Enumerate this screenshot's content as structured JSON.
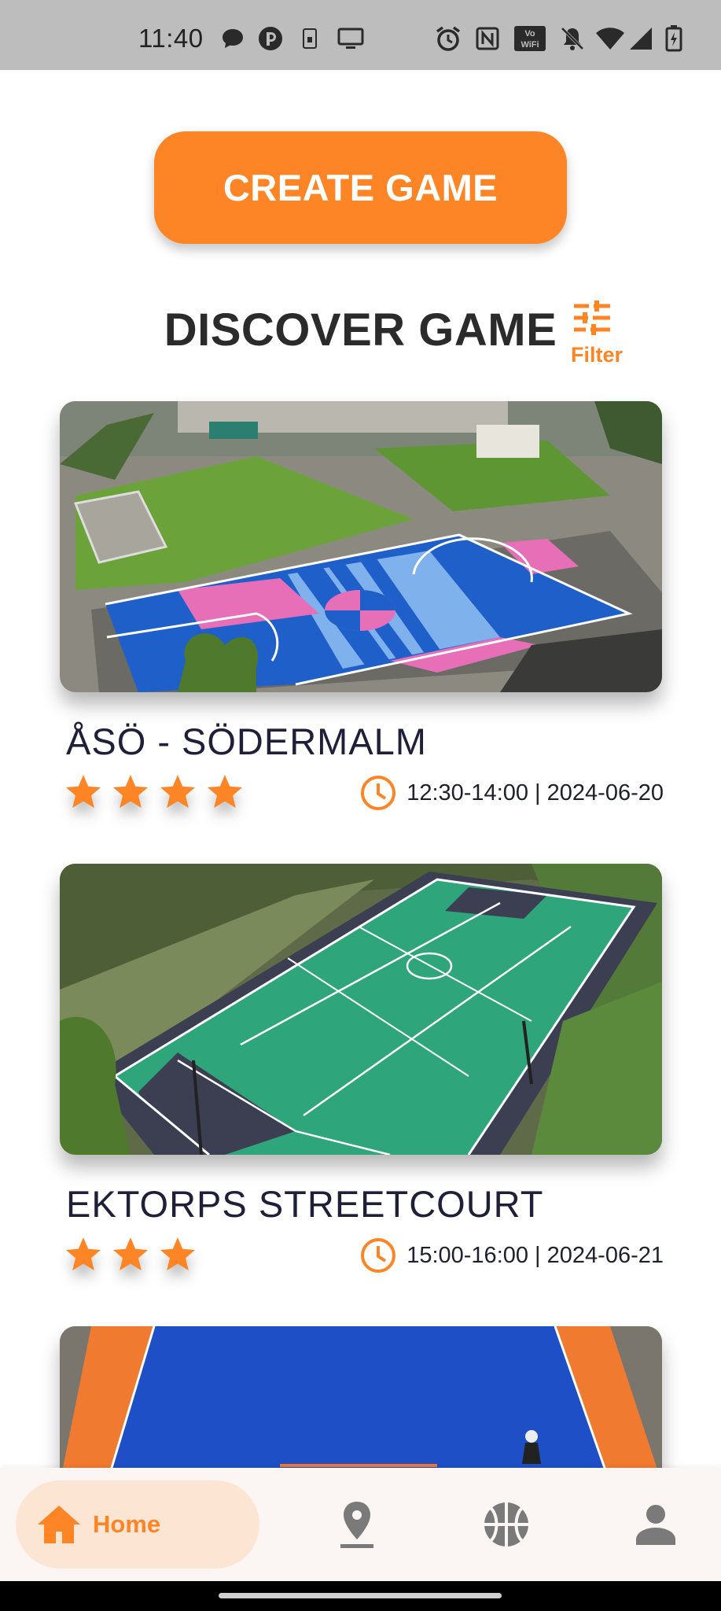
{
  "status_bar": {
    "time": "11:40",
    "icons": [
      "message-bubble-icon",
      "app-indicator-icon",
      "sd-card-icon",
      "cast-screen-icon",
      "alarm-icon",
      "nfc-icon",
      "vowifi-icon",
      "mute-icon",
      "wifi-icon",
      "signal-icon",
      "battery-icon"
    ],
    "vowifi_text": "VoWiFi"
  },
  "create_button": {
    "label": "CREATE GAME"
  },
  "discover": {
    "title": "DISCOVER GAME",
    "filter_label": "Filter",
    "filter_icon": "tune-sliders-icon"
  },
  "games": [
    {
      "name": "ÅSÖ  -  SÖDERMALM",
      "rating": 4,
      "time": "12:30-14:00 | 2024-06-20",
      "image": "aerial-court-blue-pink"
    },
    {
      "name": "EKTORPS  STREETCOURT",
      "rating": 3,
      "time": "15:00-16:00 | 2024-06-21",
      "image": "aerial-court-green"
    },
    {
      "name": "",
      "rating": 0,
      "time": "",
      "image": "aerial-court-blue-orange"
    }
  ],
  "nav": {
    "home_label": "Home",
    "items": [
      "home-icon",
      "location-pin-icon",
      "basketball-icon",
      "person-icon"
    ]
  },
  "colors": {
    "accent": "#fd8526",
    "home_pill": "#fde5d4",
    "nav_bg": "#fbf6f4",
    "status_bar": "#bdbdbd",
    "icon_gray": "#7a7a7a"
  }
}
